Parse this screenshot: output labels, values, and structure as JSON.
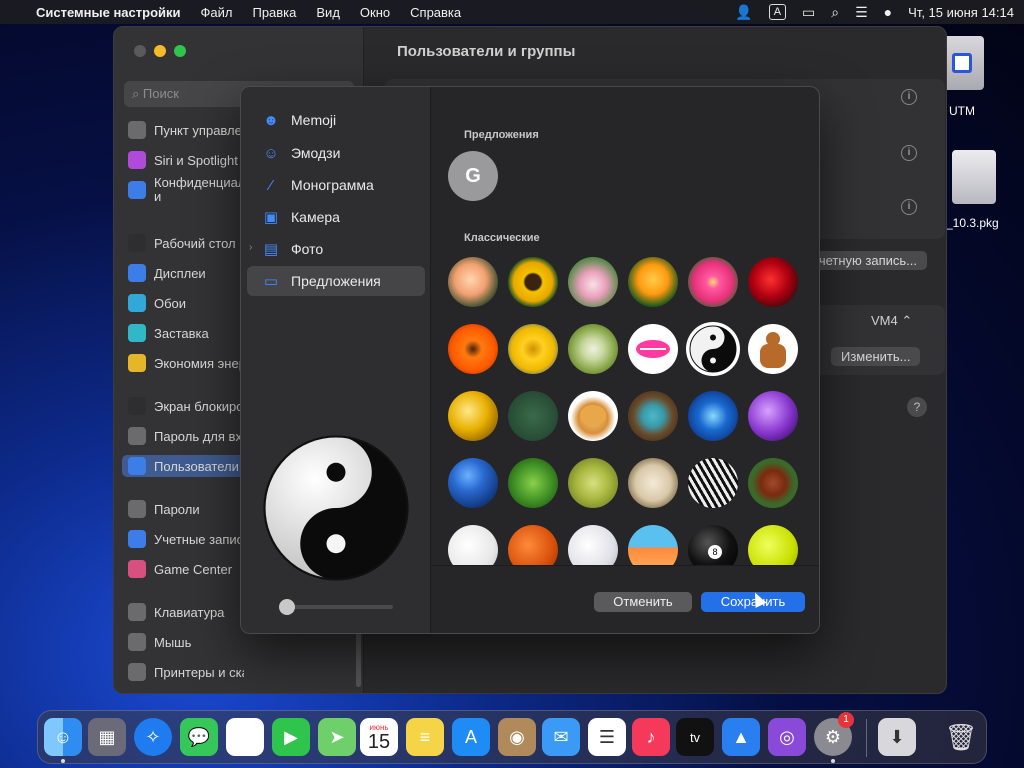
{
  "menubar": {
    "app": "Системные настройки",
    "items": [
      "Файл",
      "Правка",
      "Вид",
      "Окно",
      "Справка"
    ],
    "datetime": "Чт, 15 июня  14:14",
    "input_source": "A"
  },
  "desktop": {
    "icons": [
      "UTM",
      "_10.3.pkg"
    ]
  },
  "settings": {
    "title": "Пользователи и группы",
    "search_placeholder": "Поиск",
    "sidebar_items": [
      {
        "label": "Пункт управления",
        "color": "#6b6b6e"
      },
      {
        "label": "Siri и Spotlight",
        "color": "#b04ad9"
      },
      {
        "label": "Конфиденциальность и безопасность",
        "color": "#3d7de8"
      },
      {
        "label": "Рабочий стол и Dock",
        "color": "#2e2e30"
      },
      {
        "label": "Дисплеи",
        "color": "#3d7de8"
      },
      {
        "label": "Обои",
        "color": "#31a8d8"
      },
      {
        "label": "Заставка",
        "color": "#31b8c8"
      },
      {
        "label": "Экономия энергии",
        "color": "#e5b52a"
      },
      {
        "label": "Экран блокировки",
        "color": "#2e2e30"
      },
      {
        "label": "Пароль для входа",
        "color": "#6b6b6e"
      },
      {
        "label": "Пользователи и группы",
        "color": "#3d7de8"
      },
      {
        "label": "Пароли",
        "color": "#6b6b6e"
      },
      {
        "label": "Учетные записи",
        "color": "#3d7de8"
      },
      {
        "label": "Game Center",
        "color": "#d85080"
      },
      {
        "label": "Клавиатура",
        "color": "#6b6b6e"
      },
      {
        "label": "Мышь",
        "color": "#6b6b6e"
      },
      {
        "label": "Принтеры и сканеры",
        "color": "#6b6b6e"
      }
    ],
    "account_button": "Добавить учетную запись...",
    "vm_value": "VM4",
    "change_button": "Изменить...",
    "help": "?"
  },
  "dialog": {
    "sidebar": [
      {
        "label": "Memoji",
        "icon": "memoji-icon"
      },
      {
        "label": "Эмодзи",
        "icon": "emoji-icon"
      },
      {
        "label": "Монограмма",
        "icon": "pencil-icon"
      },
      {
        "label": "Камера",
        "icon": "camera-icon"
      },
      {
        "label": "Фото",
        "icon": "photos-icon"
      },
      {
        "label": "Предложения",
        "icon": "folder-icon"
      }
    ],
    "selected": "Предложения",
    "section_suggestions": "Предложения",
    "monogram_letter": "G",
    "section_classic": "Классические",
    "pictures": [
      "rose-peach",
      "sunflower",
      "lotus",
      "poppy",
      "dahlia",
      "red-rose",
      "orange-gerbera",
      "yellow-daisy",
      "dandelion",
      "lips",
      "yin-yang",
      "gingerbread",
      "gold-medal",
      "chalkboard",
      "fortune-cookie",
      "eggs-nest",
      "blue-crackle",
      "lightning",
      "earth",
      "green-leaf",
      "yellow-leaf",
      "sand-dollar",
      "zebra",
      "football",
      "baseball",
      "basketball",
      "golf-ball",
      "beach-chair",
      "eight-ball",
      "tennis-ball"
    ],
    "selected_picture": "yin-yang",
    "cancel_label": "Отменить",
    "save_label": "Сохранить"
  },
  "dock": {
    "calendar_month": "июнь",
    "calendar_day": "15",
    "tv_label": "tv",
    "settings_badge": "1",
    "apps": [
      "Finder",
      "Launchpad",
      "Safari",
      "Сообщения",
      "Фото",
      "FaceTime",
      "Карты",
      "Календарь",
      "Заметки",
      "App Store",
      "Контакты",
      "Почта",
      "Напоминания",
      "Музыка",
      "TV",
      "Keynote",
      "Podcasts",
      "Системные настройки",
      "Загрузки",
      "Корзина"
    ]
  }
}
